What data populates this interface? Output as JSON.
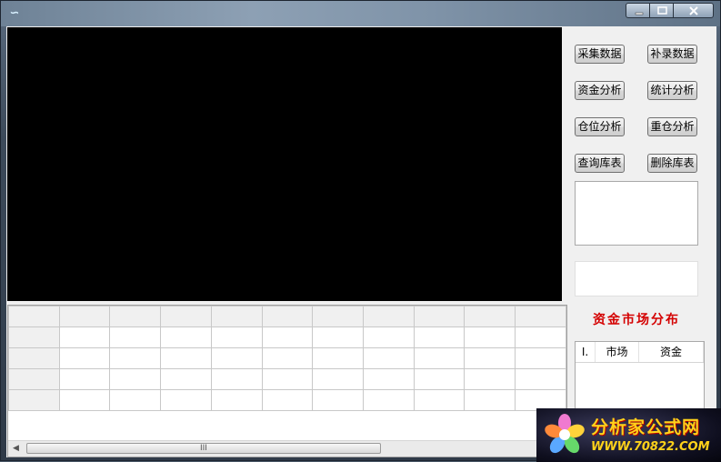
{
  "window": {
    "icon": "app-icon",
    "controls": {
      "minimize": "minimize-icon",
      "maximize": "maximize-icon",
      "close": "close-icon"
    }
  },
  "buttons": {
    "collect": "采集数据",
    "supplement": "补录数据",
    "fund_analysis": "资金分析",
    "stat_analysis": "统计分析",
    "position_analysis": "仓位分析",
    "heavy_position_analysis": "重仓分析",
    "query_table": "查询库表",
    "delete_table": "删除库表"
  },
  "distribution": {
    "title": "资金市场分布",
    "columns": [
      "I.",
      "市场",
      "资金"
    ]
  },
  "grid": {
    "scroll_grip": "III"
  },
  "logo": {
    "name": "分析家公式网",
    "url": "WWW.70822.COM"
  },
  "colors": {
    "title_red": "#d40000",
    "logo_yellow": "#ffd21a"
  }
}
